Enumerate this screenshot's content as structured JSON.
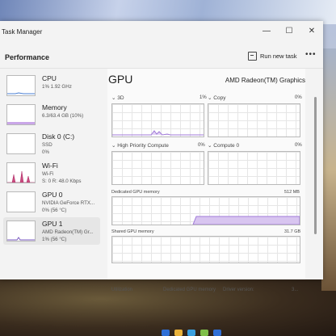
{
  "window": {
    "title": "Task Manager"
  },
  "header": {
    "page": "Performance",
    "run_task": "Run new task",
    "more": "•••"
  },
  "sidebar": {
    "items": [
      {
        "name": "CPU",
        "sub1": "1% 1.92 GHz",
        "sub2": ""
      },
      {
        "name": "Memory",
        "sub1": "6.3/63.4 GB (10%)",
        "sub2": ""
      },
      {
        "name": "Disk 0 (C:)",
        "sub1": "SSD",
        "sub2": "0%"
      },
      {
        "name": "Wi-Fi",
        "sub1": "Wi-Fi",
        "sub2": "S: 0 R: 48.0 Kbps"
      },
      {
        "name": "GPU 0",
        "sub1": "NVIDIA GeForce RTX...",
        "sub2": "0% (56 °C)"
      },
      {
        "name": "GPU 1",
        "sub1": "AMD Radeon(TM) Gr...",
        "sub2": "1% (56 °C)"
      }
    ]
  },
  "main": {
    "title": "GPU",
    "model": "AMD Radeon(TM) Graphics",
    "engines": [
      {
        "label": "3D",
        "pct": "1%"
      },
      {
        "label": "Copy",
        "pct": "0%"
      },
      {
        "label": "High Priority Compute",
        "pct": "0%"
      },
      {
        "label": "Compute 0",
        "pct": "0%"
      }
    ],
    "dedicated": {
      "label": "Dedicated GPU memory",
      "max": "512 MB"
    },
    "shared": {
      "label": "Shared GPU memory",
      "max": "31.7 GB"
    },
    "bottom": {
      "utilization": "Utilization",
      "dedicated": "Dedicated GPU memory",
      "driver": "Driver version:",
      "driver_value": "3..."
    }
  },
  "colors": {
    "accent": "#b48be0",
    "fill": "#d8c5f0"
  }
}
